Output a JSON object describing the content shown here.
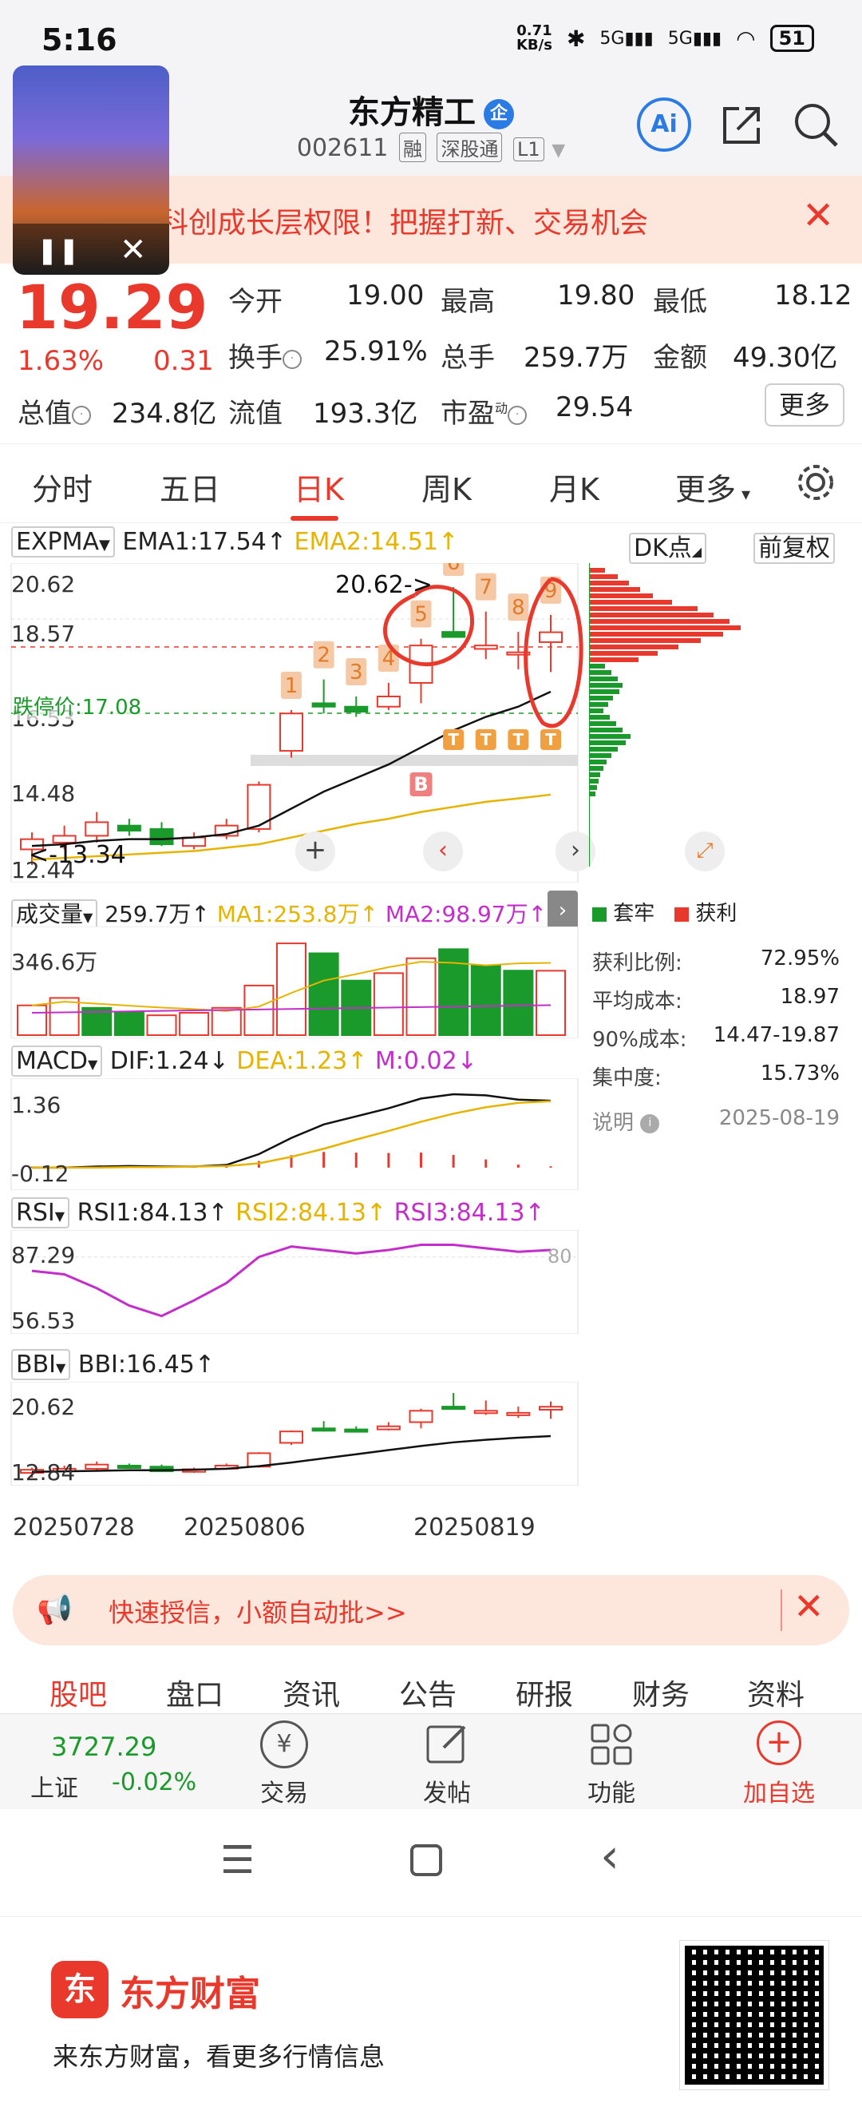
{
  "status_bar": {
    "time": "5:16",
    "net_speed": "0.71",
    "net_unit": "KB/s",
    "battery": "51"
  },
  "header": {
    "name": "东方精工",
    "name_badge": "企",
    "code": "002611",
    "tags": [
      "融",
      "深股通",
      "L1"
    ],
    "ai_label": "Ai"
  },
  "promo": {
    "text": "科创成长层权限！把握打新、交易机会"
  },
  "quote": {
    "price": "19.29",
    "change_pct": "1.63%",
    "change": "0.31",
    "rows": [
      [
        {
          "label": "今开",
          "value": "19.00",
          "color": "red"
        },
        {
          "label": "最高",
          "value": "19.80",
          "color": "red"
        },
        {
          "label": "最低",
          "value": "18.12",
          "color": "green"
        }
      ],
      [
        {
          "label": "换手",
          "value": "25.91%",
          "color": "dark"
        },
        {
          "label": "总手",
          "value": "259.7万",
          "color": "dark"
        },
        {
          "label": "金额",
          "value": "49.30亿",
          "color": "dark"
        }
      ],
      [
        {
          "label": "总值",
          "value": "234.8亿",
          "color": "dark"
        },
        {
          "label": "流值",
          "value": "193.3亿",
          "color": "dark"
        },
        {
          "label": "市盈",
          "value": "29.54",
          "color": "dark"
        }
      ]
    ],
    "pe_superscript": "动",
    "more_label": "更多"
  },
  "period_tabs": [
    "分时",
    "五日",
    "日K",
    "周K",
    "月K",
    "更多"
  ],
  "active_period": "日K",
  "chart": {
    "main_indicator": "EXPMA",
    "ema1": "EMA1:17.54",
    "ema2": "EMA2:14.51",
    "dk_label": "DK点",
    "adjust_label": "前复权",
    "y_top": "20.62",
    "y_mid": "18.57",
    "y_low1": "16.53",
    "y_low2": "14.48",
    "y_bottom": "12.44",
    "limit_label": "跌停价:17.08",
    "max_label": "20.62->",
    "min_label": "<-13.34",
    "marks": [
      "1",
      "2",
      "3",
      "4",
      "5",
      "6",
      "7",
      "8",
      "9"
    ],
    "b_mark": "B",
    "t_mark": "T",
    "colors": {
      "up": "#e8392c",
      "down": "#1a9a2a",
      "ema1": "#111111",
      "ema2": "#e6b400",
      "ma2": "#c32ecb"
    },
    "dates": [
      "20250728",
      "20250806",
      "20250819"
    ]
  },
  "chart_data": {
    "type": "candlestick",
    "ohlc": [
      {
        "o": 12.9,
        "h": 13.4,
        "l": 12.44,
        "c": 13.2,
        "up": true
      },
      {
        "o": 13.1,
        "h": 13.6,
        "l": 12.9,
        "c": 13.3,
        "up": true
      },
      {
        "o": 13.3,
        "h": 14.0,
        "l": 13.1,
        "c": 13.7,
        "up": true
      },
      {
        "o": 13.6,
        "h": 13.8,
        "l": 13.3,
        "c": 13.45,
        "up": false
      },
      {
        "o": 13.5,
        "h": 13.7,
        "l": 13.0,
        "c": 13.05,
        "up": false
      },
      {
        "o": 13.0,
        "h": 13.4,
        "l": 12.9,
        "c": 13.25,
        "up": true
      },
      {
        "o": 13.3,
        "h": 13.8,
        "l": 13.2,
        "c": 13.6,
        "up": true
      },
      {
        "o": 13.5,
        "h": 14.9,
        "l": 13.4,
        "c": 14.8,
        "up": true
      },
      {
        "o": 15.8,
        "h": 17.0,
        "l": 15.6,
        "c": 16.9,
        "up": true
      },
      {
        "o": 17.1,
        "h": 17.9,
        "l": 16.9,
        "c": 17.2,
        "up": false
      },
      {
        "o": 17.1,
        "h": 17.4,
        "l": 16.8,
        "c": 16.95,
        "up": false
      },
      {
        "o": 17.1,
        "h": 17.8,
        "l": 17.0,
        "c": 17.4,
        "up": true
      },
      {
        "o": 17.8,
        "h": 19.1,
        "l": 17.2,
        "c": 18.9,
        "up": true
      },
      {
        "o": 19.3,
        "h": 20.62,
        "l": 19.2,
        "c": 19.15,
        "up": false
      },
      {
        "o": 18.9,
        "h": 19.9,
        "l": 18.5,
        "c": 18.8,
        "up": true
      },
      {
        "o": 18.7,
        "h": 19.3,
        "l": 18.2,
        "c": 18.7,
        "up": true
      },
      {
        "o": 19.0,
        "h": 19.8,
        "l": 18.12,
        "c": 19.29,
        "up": true
      }
    ],
    "ema1": [
      13.0,
      13.05,
      13.15,
      13.2,
      13.2,
      13.25,
      13.35,
      13.6,
      14.1,
      14.6,
      15.0,
      15.4,
      15.9,
      16.4,
      16.8,
      17.1,
      17.54
    ],
    "ema2": [
      12.6,
      12.65,
      12.7,
      12.75,
      12.8,
      12.85,
      12.95,
      13.05,
      13.25,
      13.45,
      13.65,
      13.8,
      14.0,
      14.15,
      14.3,
      14.4,
      14.51
    ],
    "volume": [
      120,
      150,
      110,
      95,
      80,
      90,
      110,
      200,
      370,
      330,
      220,
      250,
      310,
      346.6,
      280,
      260,
      259.7
    ],
    "volume_up": [
      true,
      true,
      false,
      false,
      true,
      true,
      true,
      true,
      true,
      false,
      false,
      true,
      true,
      false,
      false,
      false,
      true
    ],
    "volume_labels": {
      "vol": "259.7万",
      "ma1": "MA1:253.8万",
      "ma2": "MA2:98.97万",
      "max": "346.6万"
    },
    "macd": {
      "dif": "DIF:1.24",
      "dea": "DEA:1.23",
      "m": "M:0.02",
      "top": "1.36",
      "bottom": "-0.12",
      "dif_series": [
        0.0,
        0.0,
        0.02,
        0.03,
        0.02,
        0.02,
        0.05,
        0.25,
        0.55,
        0.8,
        0.95,
        1.1,
        1.28,
        1.36,
        1.34,
        1.26,
        1.24
      ],
      "dea_series": [
        0.0,
        0.0,
        0.0,
        0.01,
        0.01,
        0.02,
        0.03,
        0.08,
        0.2,
        0.35,
        0.52,
        0.68,
        0.85,
        1.0,
        1.12,
        1.2,
        1.23
      ]
    },
    "rsi": {
      "rsi1": "RSI1:84.13",
      "rsi2": "RSI2:84.13",
      "rsi3": "RSI3:84.13",
      "top": "87.29",
      "bottom": "56.53",
      "ref": "80",
      "series": [
        72,
        70,
        62,
        52,
        46,
        55,
        65,
        80,
        86,
        84,
        82,
        84,
        87,
        87,
        85,
        83,
        84
      ]
    },
    "bbi": {
      "label": "BBI:16.45",
      "top": "20.62",
      "bottom": "12.84",
      "series": [
        13.0,
        13.05,
        13.1,
        13.15,
        13.15,
        13.2,
        13.3,
        13.55,
        13.9,
        14.3,
        14.7,
        15.1,
        15.5,
        15.85,
        16.1,
        16.3,
        16.45
      ]
    }
  },
  "side_panel": {
    "legend": [
      {
        "label": "套牢",
        "color": "#1a9a2a"
      },
      {
        "label": "获利",
        "color": "#e8392c"
      }
    ],
    "rows": [
      {
        "label": "获利比例:",
        "value": "72.95%"
      },
      {
        "label": "平均成本:",
        "value": "18.97"
      },
      {
        "label": "90%成本:",
        "value": "14.47-19.87"
      },
      {
        "label": "集中度:",
        "value": "15.73%"
      }
    ],
    "note_label": "说明",
    "note_date": "2025-08-19"
  },
  "chip_distribution": {
    "profit_bars": [
      20,
      36,
      50,
      64,
      80,
      104,
      136,
      156,
      176,
      190,
      168,
      140,
      112,
      86,
      62
    ],
    "trapped_bars": [
      20,
      28,
      36,
      42,
      38,
      30,
      24,
      18,
      26,
      34,
      42,
      52,
      46,
      36,
      28,
      22,
      18,
      14,
      12,
      10,
      8
    ]
  },
  "ad": {
    "text": "快速授信，小额自动批>>"
  },
  "sub_tabs": [
    "股吧",
    "盘口",
    "资讯",
    "公告",
    "研报",
    "财务",
    "资料"
  ],
  "toolbar": {
    "index_value": "3727.29",
    "index_name": "上证",
    "index_change": "-0.02%",
    "items": [
      "交易",
      "发帖",
      "功能",
      "加自选"
    ]
  },
  "footer": {
    "brand": "东方财富",
    "slogan": "来东方财富，看更多行情信息"
  }
}
